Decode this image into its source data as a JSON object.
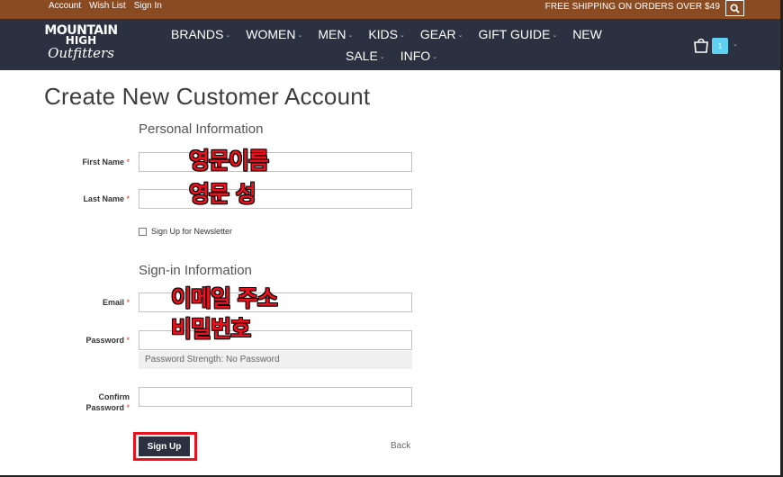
{
  "topbar": {
    "links": [
      "Account",
      "Wish List",
      "Sign In"
    ],
    "shipping": "FREE SHIPPING ON ORDERS OVER $49"
  },
  "logo": {
    "line1": "MOUNTAIN",
    "line2": "HIGH",
    "line3": "Outfitters"
  },
  "nav": {
    "row1": [
      {
        "label": "BRANDS",
        "dropdown": true
      },
      {
        "label": "WOMEN",
        "dropdown": true
      },
      {
        "label": "MEN",
        "dropdown": true
      },
      {
        "label": "KIDS",
        "dropdown": true
      },
      {
        "label": "GEAR",
        "dropdown": true
      },
      {
        "label": "GIFT GUIDE",
        "dropdown": true
      },
      {
        "label": "NEW",
        "dropdown": false
      }
    ],
    "row2": [
      {
        "label": "SALE",
        "dropdown": true
      },
      {
        "label": "INFO",
        "dropdown": true
      }
    ]
  },
  "cart": {
    "count": "1"
  },
  "page": {
    "title": "Create New Customer Account"
  },
  "personal": {
    "title": "Personal Information",
    "first_name_label": "First Name",
    "last_name_label": "Last Name",
    "newsletter_label": "Sign Up for Newsletter"
  },
  "signin": {
    "title": "Sign-in Information",
    "email_label": "Email",
    "password_label": "Password",
    "strength": "Password Strength: No Password",
    "confirm_label_1": "Confirm",
    "confirm_label_2": "Password"
  },
  "annotations": {
    "first_name": "영문이름",
    "last_name": "영문 성",
    "email": "이메일 주소",
    "password": "비밀번호"
  },
  "actions": {
    "signup": "Sign Up",
    "back": "Back"
  },
  "colors": {
    "topbar": "#8a4a22",
    "header": "#2b3140",
    "annotation": "#e8111d",
    "badge": "#5fd0f0"
  }
}
